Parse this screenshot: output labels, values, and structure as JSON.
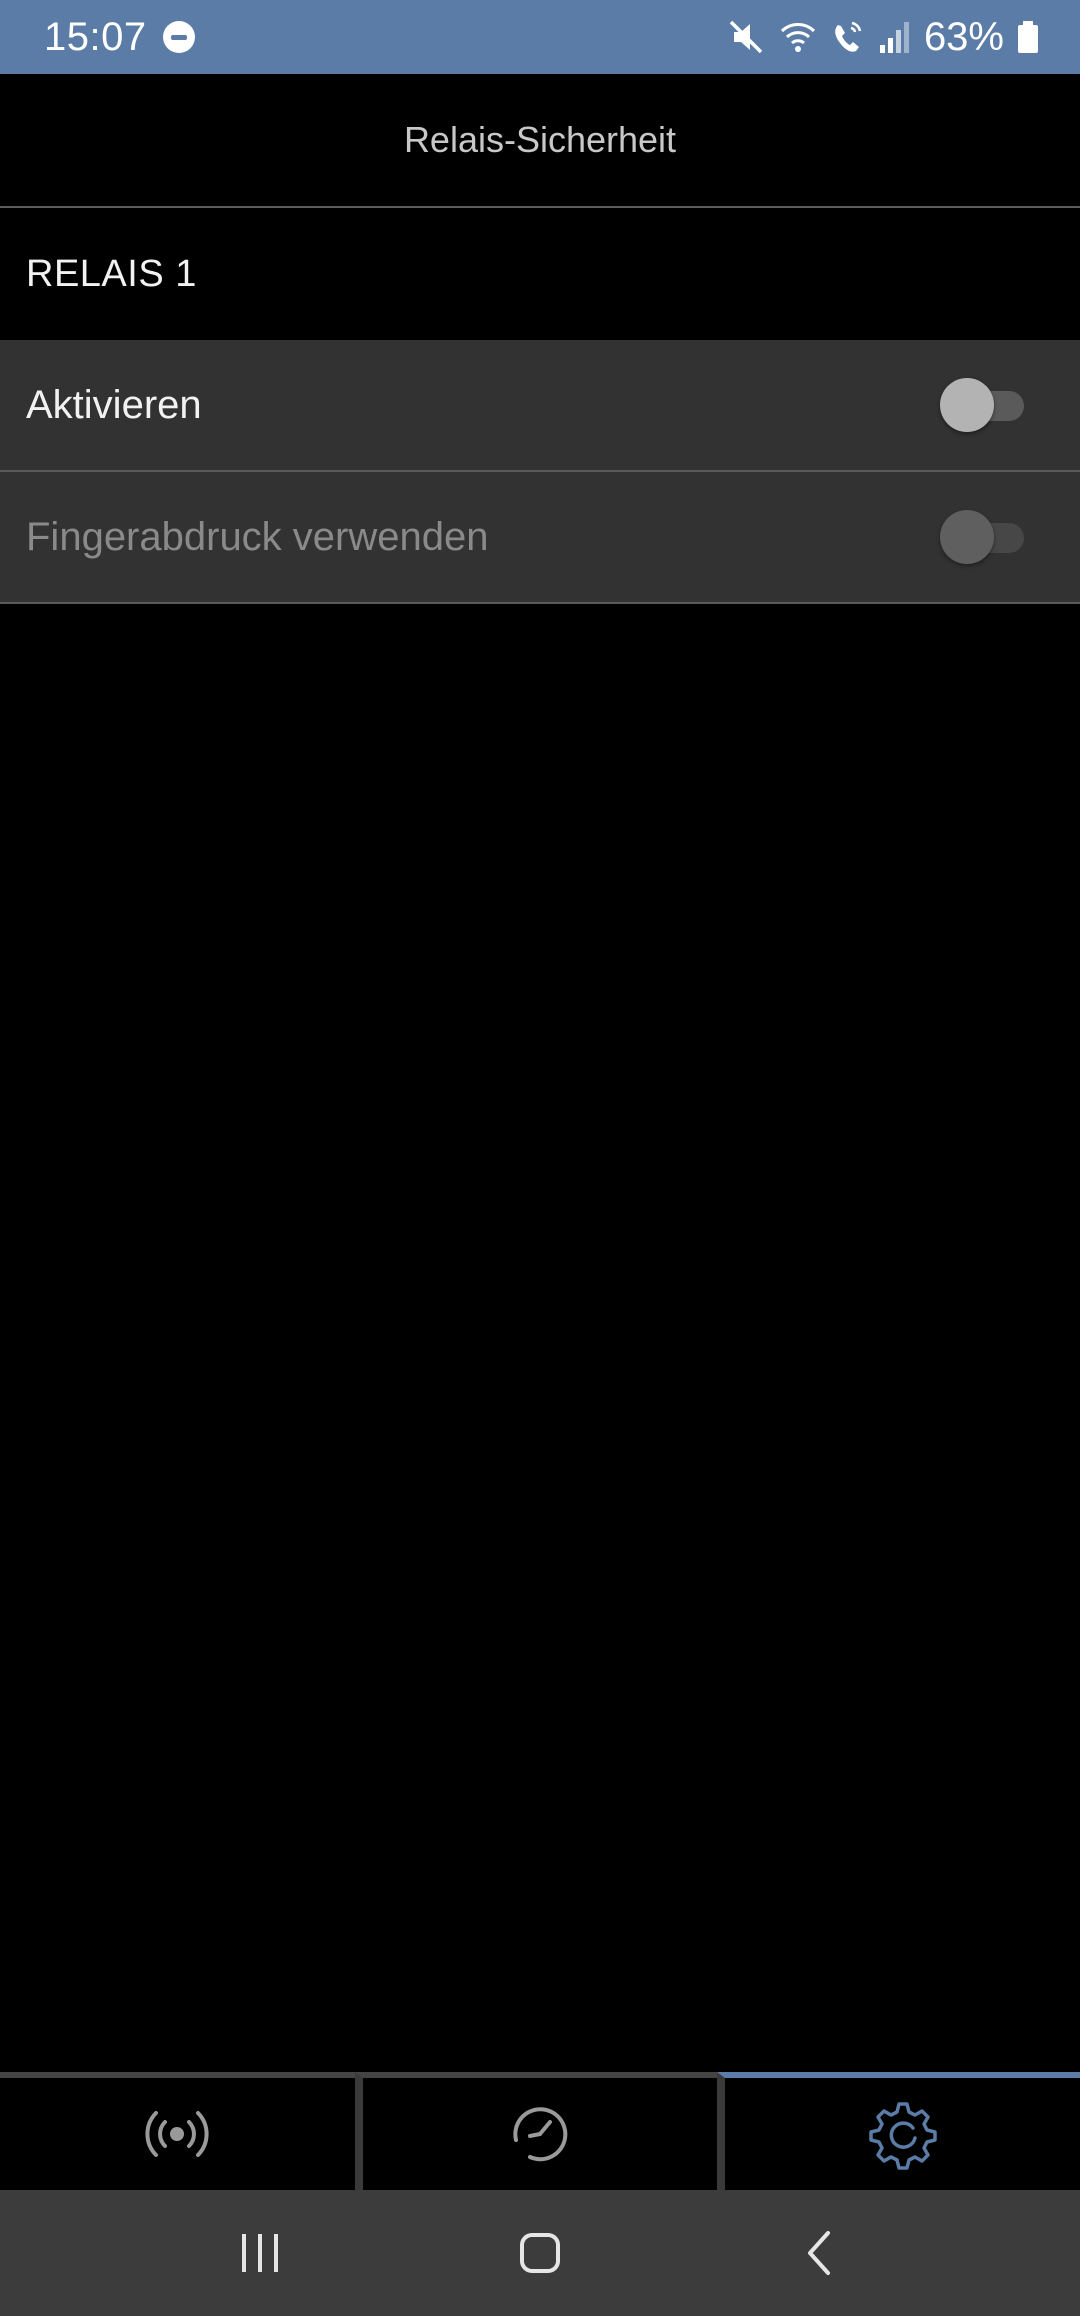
{
  "status_bar": {
    "time": "15:07",
    "battery_percent": "63%",
    "icons": [
      "do-not-disturb-icon",
      "mute-icon",
      "wifi-icon",
      "wifi-call-icon",
      "signal-icon",
      "battery-icon"
    ]
  },
  "header": {
    "title": "Relais-Sicherheit"
  },
  "section": {
    "label": "RELAIS 1"
  },
  "settings": [
    {
      "label": "Aktivieren",
      "enabled": true,
      "checked": false
    },
    {
      "label": "Fingerabdruck verwenden",
      "enabled": false,
      "checked": false
    }
  ],
  "tabs": [
    {
      "icon": "broadcast-icon",
      "active": false
    },
    {
      "icon": "clock-icon",
      "active": false
    },
    {
      "icon": "settings-gear-icon",
      "active": true
    }
  ],
  "navigation": [
    "recent-apps-icon",
    "home-icon",
    "back-icon"
  ],
  "colors": {
    "accent": "#5a7ca6",
    "row_background": "#323232",
    "background": "#000000",
    "nav_background": "#3c3c3c"
  }
}
